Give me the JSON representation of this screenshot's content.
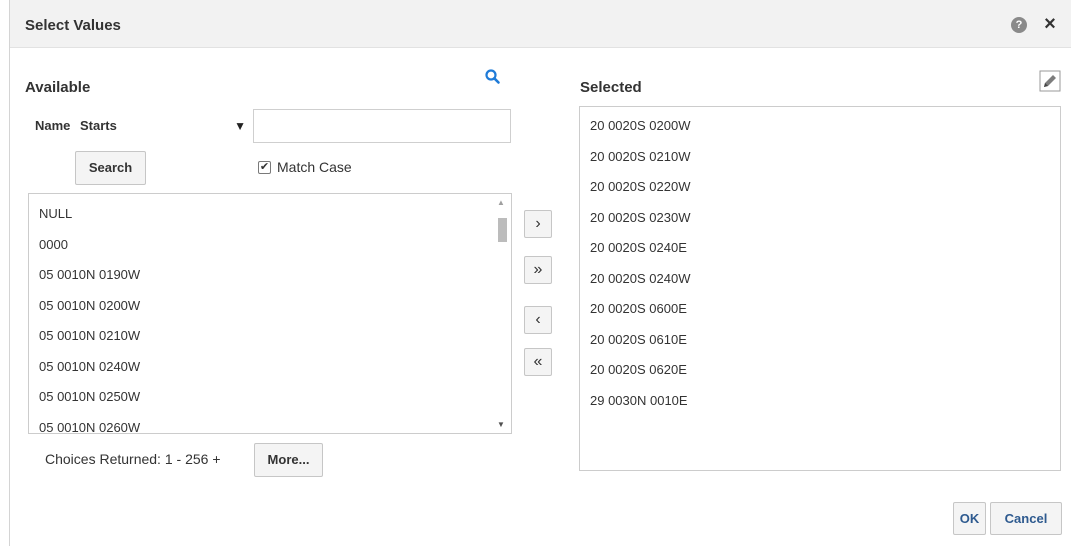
{
  "dialog": {
    "title": "Select Values",
    "help_icon": "help-icon",
    "close_icon": "close-icon"
  },
  "available": {
    "label": "Available",
    "search_icon": "search-icon",
    "name_label": "Name",
    "operator": "Starts",
    "name_value": "",
    "search_label": "Search",
    "match_case_label": "Match Case",
    "match_case_checked": true,
    "items": [
      "NULL",
      "0000",
      "05 0010N 0190W",
      "05 0010N 0200W",
      "05 0010N 0210W",
      "05 0010N 0240W",
      "05 0010N 0250W",
      "05 0010N 0260W"
    ],
    "choices_text": "Choices Returned: 1 - 256 +",
    "more_label": "More..."
  },
  "shuttle": {
    "move": "›",
    "move_all": "»",
    "remove": "‹",
    "remove_all": "«"
  },
  "selected": {
    "label": "Selected",
    "edit_icon": "pencil-icon",
    "items": [
      "20 0020S 0200W",
      "20 0020S 0210W",
      "20 0020S 0220W",
      "20 0020S 0230W",
      "20 0020S 0240E",
      "20 0020S 0240W",
      "20 0020S 0600E",
      "20 0020S 0610E",
      "20 0020S 0620E",
      "29 0030N 0010E"
    ]
  },
  "footer": {
    "ok_label": "OK",
    "cancel_label": "Cancel"
  },
  "colors": {
    "header_bg": "#f2f2f2",
    "icon_blue": "#1f7bd8",
    "button_text_blue": "#2e5a8f"
  }
}
